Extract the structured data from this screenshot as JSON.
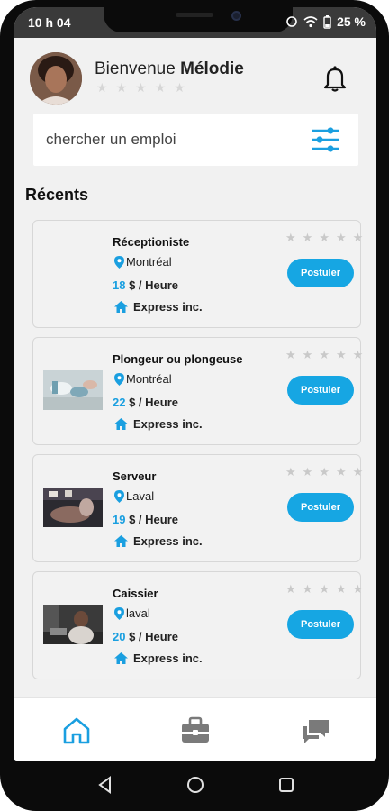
{
  "status_bar": {
    "time": "10 h 04",
    "battery": "25 %"
  },
  "header": {
    "greeting": "Bienvenue",
    "user_name": "Mélodie",
    "rating_stars": 5
  },
  "search": {
    "placeholder": "chercher un emploi"
  },
  "section": {
    "recent_title": "Récents"
  },
  "jobs": [
    {
      "title": "Réceptioniste",
      "location": "Montréal",
      "pay_amount": "18",
      "pay_unit": "$ / Heure",
      "company": "Express inc.",
      "apply_label": "Postuler"
    },
    {
      "title": "Plongeur ou plongeuse",
      "location": "Montréal",
      "pay_amount": "22",
      "pay_unit": "$ / Heure",
      "company": "Express inc.",
      "apply_label": "Postuler"
    },
    {
      "title": "Serveur",
      "location": "Laval",
      "pay_amount": "19",
      "pay_unit": "$ / Heure",
      "company": "Express inc.",
      "apply_label": "Postuler"
    },
    {
      "title": "Caissier",
      "location": "laval",
      "pay_amount": "20",
      "pay_unit": "$ / Heure",
      "company": "Express inc.",
      "apply_label": "Postuler"
    }
  ],
  "bottom_nav": [
    {
      "name": "home",
      "icon": "home-icon",
      "active": true
    },
    {
      "name": "jobs",
      "icon": "briefcase-icon",
      "active": false
    },
    {
      "name": "messages",
      "icon": "chat-icon",
      "active": false
    }
  ],
  "colors": {
    "accent": "#16a6e3",
    "background": "#f1f1f1",
    "star_inactive": "#d6d6d6"
  }
}
